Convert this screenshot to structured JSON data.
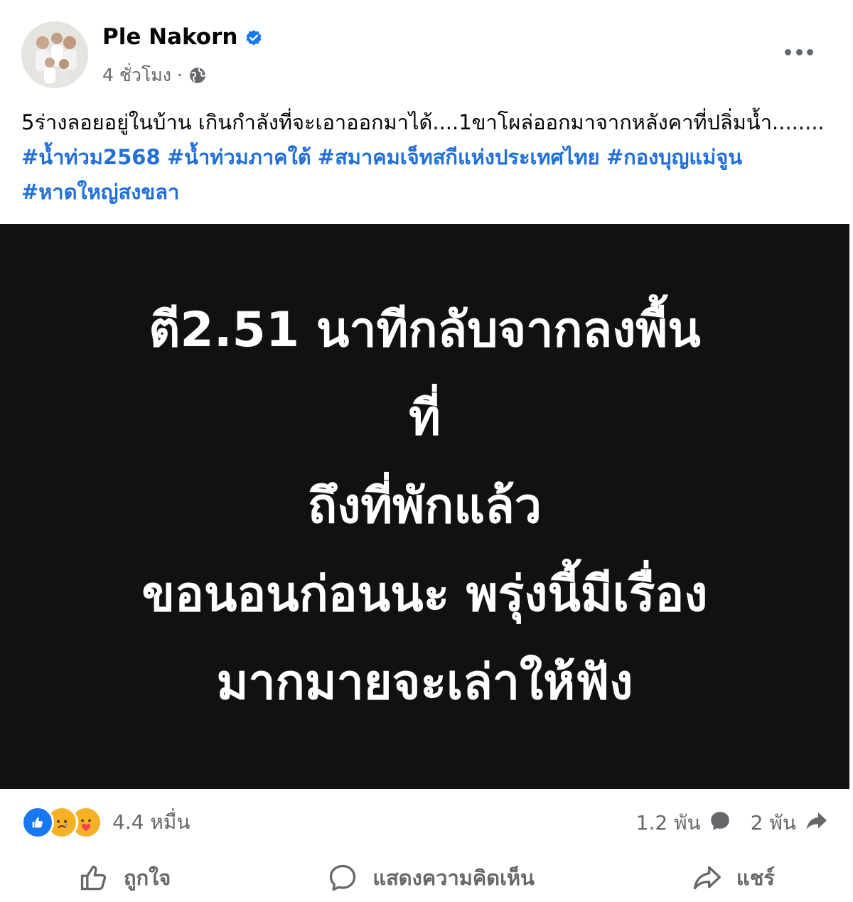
{
  "post": {
    "author": "Ple Nakorn",
    "time": "4 ชั่วโมง ·",
    "caption_text": "5ร่างลอยอยู่ในบ้าน เกินกำลังที่จะเอาออกมาได้....1ขาโผล่ออกมาจากหลังคาที่ปลิ่มน้ำ........ ",
    "hashtags": [
      "#น้ำท่วม2568",
      "#น้ำท่วมภาคใต้",
      "#สมาคมเจ็ทสกีแห่งประเทศไทย",
      "#กองบุญแม่จูน",
      "#หาดใหญ่สงขลา"
    ]
  },
  "image": {
    "lines": [
      "ตี2.51 นาทีกลับจากลงพื้น",
      "ที่",
      "ถึงที่พักแล้ว",
      "ขอนอนก่อนนะ พรุ่งนี้มีเรื่อง",
      "มากมายจะเล่าให้ฟัง"
    ]
  },
  "stats": {
    "reactions": "4.4 หมื่น",
    "comments": "1.2 พัน",
    "shares": "2 พัน"
  },
  "actions": {
    "like": "ถูกใจ",
    "comment": "แสดงความคิดเห็น",
    "share": "แชร์"
  },
  "icons": {
    "verified": "verified-badge-icon",
    "privacy": "globe-icon",
    "more": "more-icon"
  },
  "colors": {
    "hashtag": "#216fdb",
    "verified": "#1877f2",
    "image_bg": "#111111"
  }
}
